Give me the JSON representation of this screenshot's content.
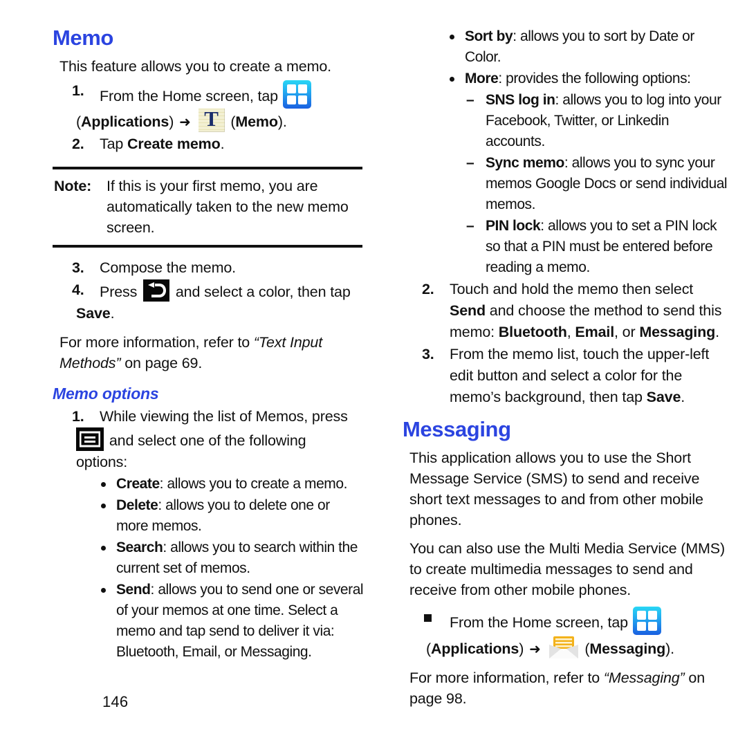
{
  "page": {
    "folio": "146",
    "accent_color": "#2b44e0",
    "text_color": "#111111",
    "background": "#ffffff"
  },
  "left_column": {
    "heading": "Memo",
    "intro": "This feature allows you to create a memo.",
    "step1": {
      "num": "1.",
      "text_before_icon": "From the Home screen, tap",
      "icon_apps": "applications-grid-icon",
      "label_apps_open": "(",
      "label_apps": "Applications",
      "label_apps_close": ")",
      "arrow": "➜",
      "icon_memo": "memo-notepad-icon",
      "label_memo_open": "(",
      "label_memo": "Memo",
      "label_memo_close": ")."
    },
    "step2": {
      "num": "2.",
      "text_before": "Tap ",
      "bold": "Create memo",
      "text_after": "."
    },
    "note": {
      "label": "Note:",
      "text": "If this is your first memo, you are automatically taken to the new memo screen."
    },
    "step3": {
      "num": "3.",
      "text": "Compose the memo."
    },
    "step4": {
      "num": "4.",
      "text_before_icon": "Press",
      "icon_back": "back-key-icon",
      "text_after_icon": "and select a color, then tap",
      "bold": "Save",
      "text_end": "."
    },
    "cross_ref": {
      "lead": "For more information, refer to ",
      "italic": "“Text Input Methods”",
      "tail": " on page 69."
    },
    "subheading": "Memo options",
    "options_step1": {
      "num": "1.",
      "text_before_icon": "While viewing the list of Memos, press",
      "icon_menu": "menu-key-icon",
      "text_after_icon": "and select one of the following",
      "text_last_line": "options:"
    },
    "options": [
      {
        "term": "Create",
        "desc": ": allows you to create a memo."
      },
      {
        "term": "Delete",
        "desc": ": allows you to delete one or more memos."
      },
      {
        "term": "Search",
        "desc": ": allows you to search within the current set of memos."
      },
      {
        "term": "Send",
        "desc": ": allows you to send one or several of your memos at one time. Select a memo and tap send to deliver it via: Bluetooth, Email, or Messaging."
      }
    ]
  },
  "right_column": {
    "options_continued": [
      {
        "term": "Sort by",
        "desc": ": allows you to sort by Date or Color."
      },
      {
        "term": "More",
        "desc": ": provides the following options:"
      }
    ],
    "more_suboptions": [
      {
        "dash": "–",
        "term": "SNS log in",
        "desc": ": allows you to log into your Facebook, Twitter, or Linkedin accounts."
      },
      {
        "dash": "–",
        "term": "Sync memo",
        "desc": ": allows you to sync your memos Google Docs or send individual memos."
      },
      {
        "dash": "–",
        "term": "PIN lock",
        "desc": ": allows you to set a PIN lock so that a PIN must be entered before reading a memo."
      }
    ],
    "step2": {
      "num": "2.",
      "part1": "Touch and hold the memo then select ",
      "bold1": "Send",
      "part2": " and choose the method to send this memo: ",
      "bold2": "Bluetooth",
      "sep1": ", ",
      "bold3": "Email",
      "sep2": ", or ",
      "bold4": "Messaging",
      "part3": "."
    },
    "step3": {
      "num": "3.",
      "part1": "From the memo list, touch the upper-left edit button and select a color for the memo’s background, then tap ",
      "bold1": "Save",
      "part2": "."
    },
    "heading": "Messaging",
    "para1": "This application allows you to use the Short Message Service (SMS) to send and receive short text messages to and from other mobile phones.",
    "para2": "You can also use the Multi Media Service (MMS) to create multimedia messages to send and receive from other mobile phones.",
    "step_square": {
      "marker": "square-bullet",
      "text_before_icon": "From the Home screen, tap",
      "icon_apps": "applications-grid-icon",
      "label_apps_open": "(",
      "label_apps": "Applications",
      "label_apps_close": ")",
      "arrow": "➜",
      "icon_messaging": "messaging-envelope-icon",
      "label_msg_open": "(",
      "label_msg": "Messaging",
      "label_msg_close": ")."
    },
    "cross_ref": {
      "lead": "For more information, refer to ",
      "italic": "“Messaging”",
      "tail": " on page 98."
    }
  }
}
